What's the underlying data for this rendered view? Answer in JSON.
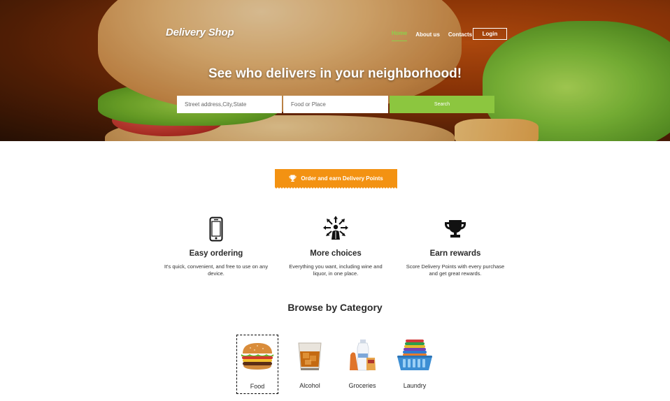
{
  "header": {
    "brand": "Delivery Shop",
    "nav": [
      "Home",
      "About us",
      "Contacts"
    ],
    "login_label": "Login",
    "active_nav": "Home"
  },
  "hero": {
    "title": "See who delivers in your neighborhood!",
    "address_placeholder": "Street address,City,State",
    "food_placeholder": "Food or Place",
    "search_label": "Search"
  },
  "order_banner": {
    "icon": "trophy-icon",
    "label": "Order and earn Delivery Points"
  },
  "features": [
    {
      "icon": "smartphone-icon",
      "title": "Easy ordering",
      "text": "It's quick, convenient, and free to use on any device."
    },
    {
      "icon": "person-choices-icon",
      "title": "More choices",
      "text": "Everything you want, including wine and liquor, in one place."
    },
    {
      "icon": "trophy-icon",
      "title": "Earn rewards",
      "text": "Score Delivery Points with every purchase and get great rewards."
    }
  ],
  "browse": {
    "title": "Browse by Category",
    "categories": [
      {
        "label": "Food",
        "icon": "burger-image",
        "selected": true
      },
      {
        "label": "Alcohol",
        "icon": "whiskey-glass-image",
        "selected": false
      },
      {
        "label": "Groceries",
        "icon": "groceries-image",
        "selected": false
      },
      {
        "label": "Laundry",
        "icon": "laundry-basket-image",
        "selected": false
      }
    ]
  },
  "colors": {
    "accent_green": "#8cc63f",
    "accent_orange": "#f39212",
    "nav_active": "#8cd04a"
  }
}
